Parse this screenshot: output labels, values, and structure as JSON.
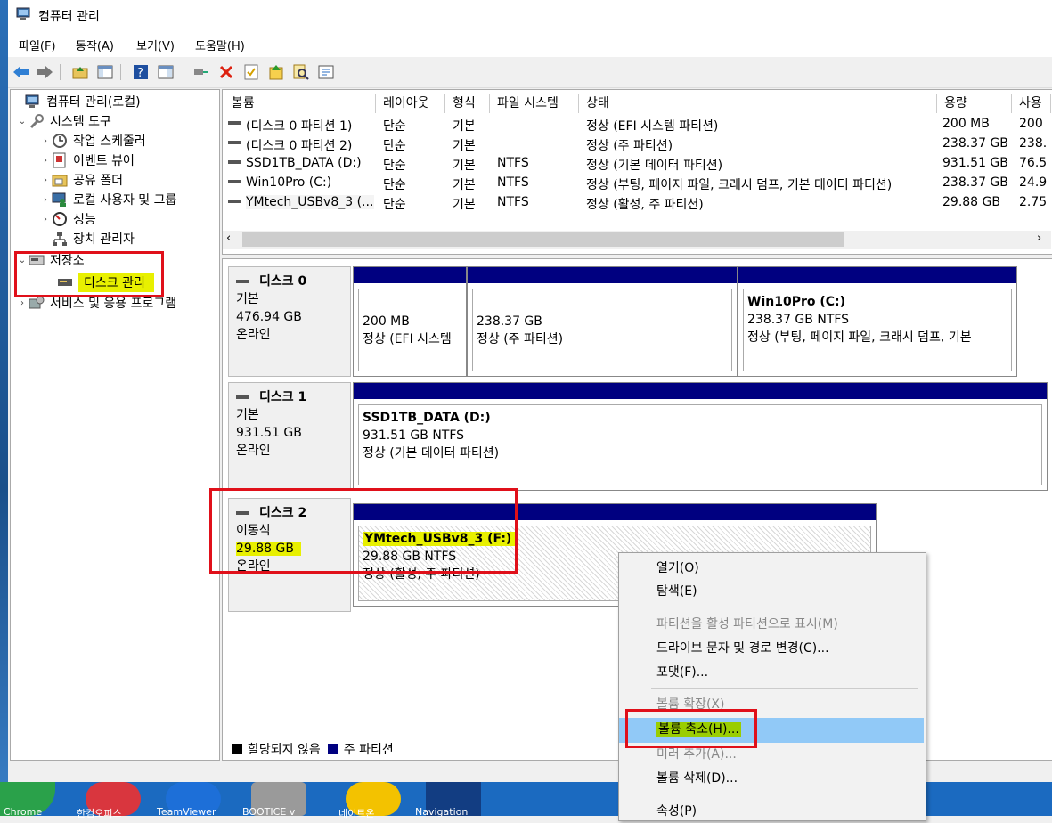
{
  "window": {
    "title": "컴퓨터 관리"
  },
  "menu": [
    "파일(F)",
    "동작(A)",
    "보기(V)",
    "도움말(H)"
  ],
  "tree": {
    "root": "컴퓨터 관리(로컬)",
    "system_tools": "시스템 도구",
    "items": [
      "작업 스케줄러",
      "이벤트 뷰어",
      "공유 폴더",
      "로컬 사용자 및 그룹",
      "성능",
      "장치 관리자"
    ],
    "storage": "저장소",
    "disk_mgmt": "디스크 관리",
    "services": "서비스 및 응용 프로그램"
  },
  "volumes": {
    "headers": [
      "볼륨",
      "레이아웃",
      "형식",
      "파일 시스템",
      "상태",
      "용량",
      "사용"
    ],
    "rows": [
      [
        "(디스크 0 파티션 1)",
        "단순",
        "기본",
        "",
        "정상 (EFI 시스템 파티션)",
        "200 MB",
        "200"
      ],
      [
        "(디스크 0 파티션 2)",
        "단순",
        "기본",
        "",
        "정상 (주 파티션)",
        "238.37 GB",
        "238."
      ],
      [
        "SSD1TB_DATA (D:)",
        "단순",
        "기본",
        "NTFS",
        "정상 (기본 데이터 파티션)",
        "931.51 GB",
        "76.5"
      ],
      [
        "Win10Pro (C:)",
        "단순",
        "기본",
        "NTFS",
        "정상 (부팅, 페이지 파일, 크래시 덤프, 기본 데이터 파티션)",
        "238.37 GB",
        "24.9"
      ],
      [
        "YMtech_USBv8_3 (...",
        "단순",
        "기본",
        "NTFS",
        "정상 (활성, 주 파티션)",
        "29.88 GB",
        "2.75"
      ]
    ]
  },
  "disks": [
    {
      "name": "디스크 0",
      "type": "기본",
      "size": "476.94 GB",
      "status": "온라인",
      "partitions": [
        {
          "title": "",
          "line1": "200 MB",
          "line2": "정상 (EFI 시스템"
        },
        {
          "title": "",
          "line1": "238.37 GB",
          "line2": "정상 (주 파티션)"
        },
        {
          "title": "Win10Pro  (C:)",
          "line1": "238.37 GB NTFS",
          "line2": "정상 (부팅, 페이지 파일, 크래시 덤프, 기본"
        }
      ]
    },
    {
      "name": "디스크 1",
      "type": "기본",
      "size": "931.51 GB",
      "status": "온라인",
      "partitions": [
        {
          "title": "SSD1TB_DATA  (D:)",
          "line1": "931.51 GB NTFS",
          "line2": "정상 (기본 데이터 파티션)"
        }
      ]
    },
    {
      "name": "디스크 2",
      "type": "이동식",
      "size": "29.88 GB",
      "status": "온라인",
      "partitions": [
        {
          "title": "YMtech_USBv8_3  (F:)",
          "line1": "29.88 GB NTFS",
          "line2": "정상 (활성, 주 파티션)"
        }
      ]
    }
  ],
  "legend": {
    "unallocated": "할당되지 않음",
    "primary": "주 파티션"
  },
  "context_menu": [
    {
      "label": "열기(O)",
      "enabled": true
    },
    {
      "label": "탐색(E)",
      "enabled": true
    },
    {
      "label": "파티션을 활성 파티션으로 표시(M)",
      "enabled": false
    },
    {
      "label": "드라이브 문자 및 경로 변경(C)...",
      "enabled": true
    },
    {
      "label": "포맷(F)...",
      "enabled": true
    },
    {
      "label": "볼륨 확장(X)",
      "enabled": false
    },
    {
      "label": "볼륨 축소(H)...",
      "enabled": true
    },
    {
      "label": "미러 추가(A)...",
      "enabled": false
    },
    {
      "label": "볼륨 삭제(D)...",
      "enabled": true
    },
    {
      "label": "속성(P)",
      "enabled": true
    }
  ],
  "desktop_labels": [
    "Chrome",
    "한컴오피스",
    "TeamViewer",
    "BOOTICE v",
    "네이트온",
    "Navigation"
  ],
  "colors": {
    "primary_partition": "#000080",
    "highlight": "#e8f000",
    "annotation_red": "#e0101a",
    "menu_active": "#91c9f7"
  }
}
